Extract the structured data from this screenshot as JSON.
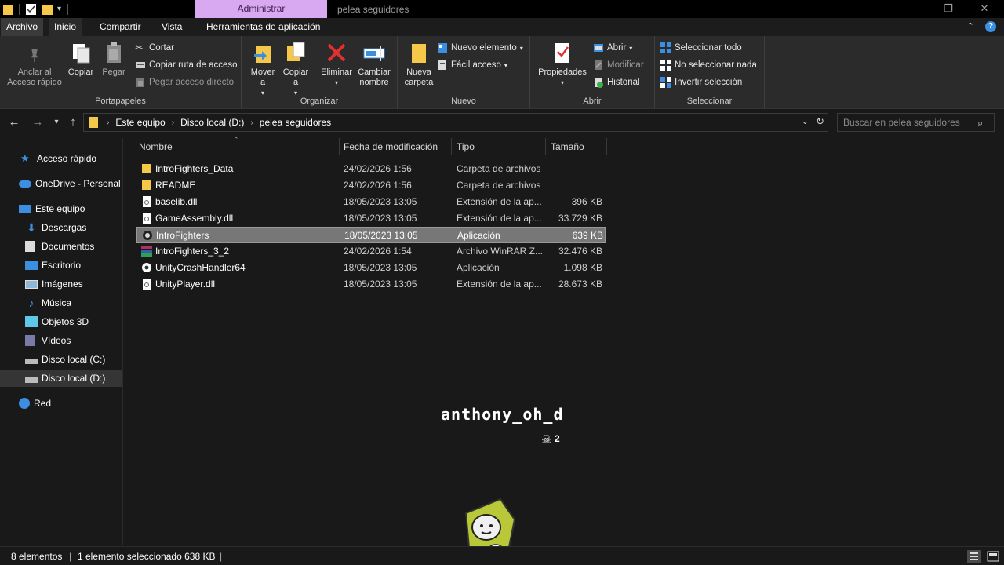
{
  "titlebar": {
    "context_tab": "Administrar",
    "window_title": "pelea seguidores",
    "buttons": {
      "minimize": "—",
      "maximize": "❐",
      "close": "✕"
    }
  },
  "ribbon_tabs": {
    "file": "Archivo",
    "home": "Inicio",
    "share": "Compartir",
    "view": "Vista",
    "app_tools": "Herramientas de aplicación"
  },
  "ribbon": {
    "portapapeles": {
      "label": "Portapapeles",
      "pin": "Anclar al Acceso rápido",
      "copy": "Copiar",
      "paste": "Pegar",
      "cut": "Cortar",
      "copy_path": "Copiar ruta de acceso",
      "paste_shortcut": "Pegar acceso directo"
    },
    "organizar": {
      "label": "Organizar",
      "move": "Mover a",
      "copyto": "Copiar a",
      "delete": "Eliminar",
      "rename": "Cambiar nombre"
    },
    "nuevo": {
      "label": "Nuevo",
      "new_folder": "Nueva carpeta",
      "new_item": "Nuevo elemento",
      "easy_access": "Fácil acceso"
    },
    "abrir": {
      "label": "Abrir",
      "properties": "Propiedades",
      "open": "Abrir",
      "edit": "Modificar",
      "history": "Historial"
    },
    "seleccionar": {
      "label": "Seleccionar",
      "select_all": "Seleccionar todo",
      "select_none": "No seleccionar nada",
      "invert": "Invertir selección"
    }
  },
  "address": {
    "crumbs": [
      "Este equipo",
      "Disco local (D:)",
      "pelea seguidores"
    ],
    "search_placeholder": "Buscar en pelea seguidores"
  },
  "nav": {
    "quick_access": "Acceso rápido",
    "onedrive": "OneDrive - Personal",
    "this_pc": "Este equipo",
    "downloads": "Descargas",
    "documents": "Documentos",
    "desktop": "Escritorio",
    "pictures": "Imágenes",
    "music": "Música",
    "objects3d": "Objetos 3D",
    "videos": "Vídeos",
    "disk_c": "Disco local (C:)",
    "disk_d": "Disco local (D:)",
    "network": "Red"
  },
  "columns": {
    "name": "Nombre",
    "modified": "Fecha de modificación",
    "type": "Tipo",
    "size": "Tamaño"
  },
  "files": [
    {
      "name": "IntroFighters_Data",
      "modified": "24/02/2026 1:56",
      "type": "Carpeta de archivos",
      "size": "",
      "icon": "folder-icon"
    },
    {
      "name": "README",
      "modified": "24/02/2026 1:56",
      "type": "Carpeta de archivos",
      "size": "",
      "icon": "folder-icon"
    },
    {
      "name": "baselib.dll",
      "modified": "18/05/2023 13:05",
      "type": "Extensión de la ap...",
      "size": "396 KB",
      "icon": "dll-file-icon"
    },
    {
      "name": "GameAssembly.dll",
      "modified": "18/05/2023 13:05",
      "type": "Extensión de la ap...",
      "size": "33.729 KB",
      "icon": "dll-file-icon"
    },
    {
      "name": "IntroFighters",
      "modified": "18/05/2023 13:05",
      "type": "Aplicación",
      "size": "639 KB",
      "icon": "app-icon"
    },
    {
      "name": "IntroFighters_3_2",
      "modified": "24/02/2026 1:54",
      "type": "Archivo WinRAR Z...",
      "size": "32.476 KB",
      "icon": "winrar-archive-icon"
    },
    {
      "name": "UnityCrashHandler64",
      "modified": "18/05/2023 13:05",
      "type": "Aplicación",
      "size": "1.098 KB",
      "icon": "unity-icon"
    },
    {
      "name": "UnityPlayer.dll",
      "modified": "18/05/2023 13:05",
      "type": "Extensión de la ap...",
      "size": "28.673 KB",
      "icon": "dll-file-icon"
    }
  ],
  "overlay": {
    "username": "anthony_oh_d",
    "count": "2"
  },
  "status": {
    "count": "8 elementos",
    "selection": "1 elemento seleccionado  638 KB"
  },
  "colors": {
    "folder": "#f5c84a",
    "accent_blue": "#3c8fe0",
    "delete_red": "#e03030",
    "context_tab": "#d8a8f0"
  }
}
